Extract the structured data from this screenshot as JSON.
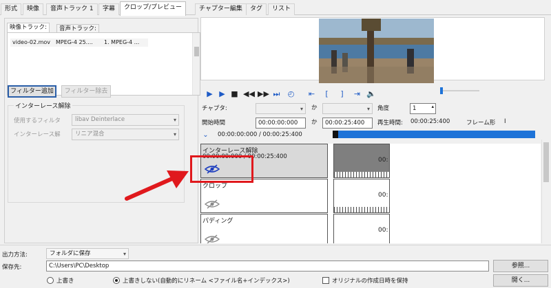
{
  "tabs": [
    {
      "label": "形式"
    },
    {
      "label": "映像"
    },
    {
      "label": "音声トラック 1"
    },
    {
      "label": "字幕"
    },
    {
      "label": "クロップ/プレビュー"
    },
    {
      "label": "チャプター編集"
    },
    {
      "label": "タグ"
    },
    {
      "label": "リスト"
    }
  ],
  "track_panel": {
    "tabs": [
      {
        "label": "映像トラック:"
      },
      {
        "label": "音声トラック:"
      }
    ],
    "row": {
      "file": "video-02.mov",
      "format": "MPEG-4 25....",
      "info": "1. MPEG-4 ..."
    }
  },
  "filter": {
    "add_label": "フィルター追加",
    "remove_label": "フィルター除去",
    "group_label": "インターレース解除",
    "use_filter_label": "使用するフィルタ",
    "use_filter_value": "libav Deinterlace",
    "method_label": "インターレース解",
    "method_value": "リニア混合"
  },
  "player": {
    "chapter_label": "チャプタ:",
    "angle_label": "角度",
    "angle_value": "1",
    "start_label": "開始時間",
    "start_value": "00:00:00:000",
    "end_value": "00:00:25:400",
    "playtime_label": "再生時間:",
    "playtime_value": "00:00:25:400",
    "frame_label": "フレーム形",
    "frame_value": "I",
    "position_text": "00:00:00:000 / 00:00:25:400",
    "colors": {
      "accent": "#1e5bc6",
      "progress": "#1e73d8"
    }
  },
  "timeline": {
    "tracks": [
      {
        "name": "インターレース解除",
        "time": "00:00:00:000 / 00:00:25:400",
        "marker": "00:"
      },
      {
        "name": "クロップ",
        "marker": "00:"
      },
      {
        "name": "パディング",
        "marker": "00:"
      }
    ]
  },
  "output": {
    "method_label": "出力方法:",
    "method_value": "フォルダに保存",
    "dest_label": "保存先:",
    "dest_value": "C:\\Users\\PC\\Desktop",
    "browse_label": "参照...",
    "open_label": "開く...",
    "overwrite_label": "上書き",
    "no_overwrite_label": "上書きしない(自動的にリネーム <ファイル名+インデックス>)",
    "keep_date_label": "オリジナルの作成日時を保持"
  },
  "annotation_color": "#e0191d"
}
